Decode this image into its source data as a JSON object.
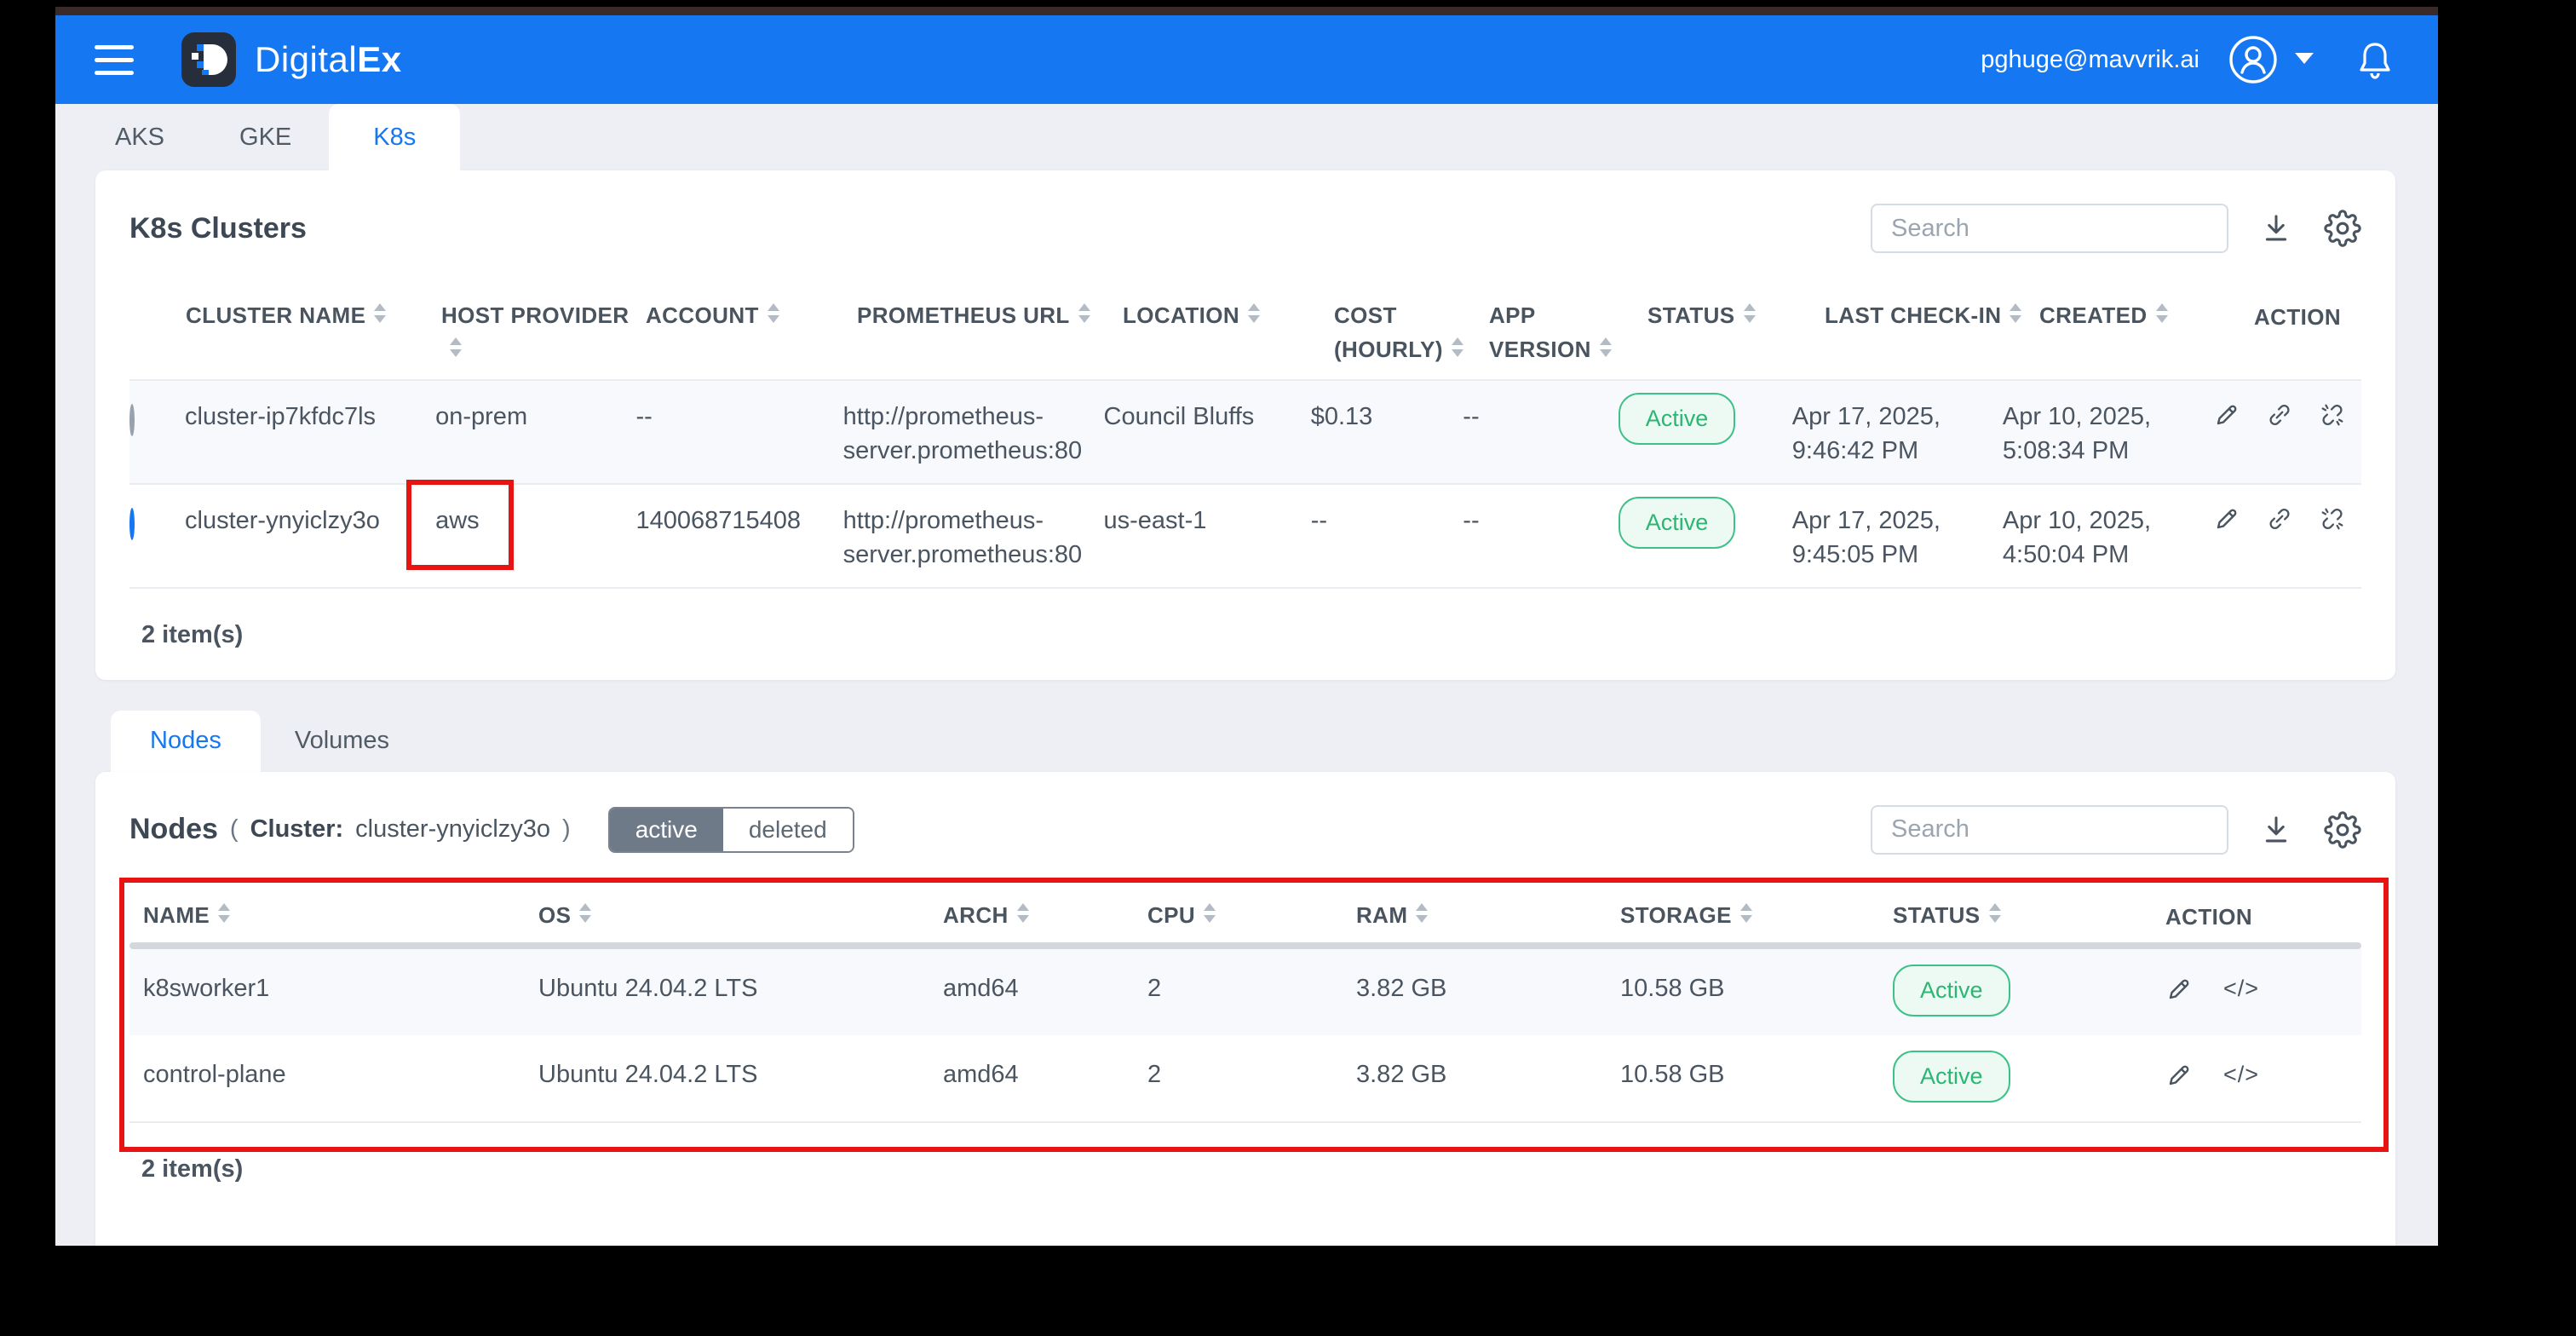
{
  "header": {
    "brand_regular": "Digital",
    "brand_bold": "Ex",
    "user_email": "pghuge@mavvrik.ai"
  },
  "provider_tabs": {
    "aks": "AKS",
    "gke": "GKE",
    "k8s": "K8s"
  },
  "clusters": {
    "title": "K8s Clusters",
    "search_placeholder": "Search",
    "columns": {
      "cluster_name": "CLUSTER NAME",
      "host_provider": "HOST PROVIDER",
      "account": "ACCOUNT",
      "prometheus_url": "PROMETHEUS URL",
      "location": "LOCATION",
      "cost_hourly": "COST (HOURLY)",
      "app_version": "APP VERSION",
      "status": "STATUS",
      "last_check_in": "LAST CHECK-IN",
      "created": "CREATED",
      "action": "ACTION"
    },
    "rows": [
      {
        "selected": false,
        "name": "cluster-ip7kfdc7ls",
        "host_provider": "on-prem",
        "account": "--",
        "prometheus_url": "http://prometheus-server.prometheus:80",
        "location": "Council Bluffs",
        "cost_hourly": "$0.13",
        "app_version": "--",
        "status": "Active",
        "last_check_in": "Apr 17, 2025, 9:46:42 PM",
        "created": "Apr 10, 2025, 5:08:34 PM"
      },
      {
        "selected": true,
        "name": "cluster-ynyiclzy3o",
        "host_provider": "aws",
        "account": "140068715408",
        "prometheus_url": "http://prometheus-server.prometheus:80",
        "location": "us-east-1",
        "cost_hourly": "--",
        "app_version": "--",
        "status": "Active",
        "last_check_in": "Apr 17, 2025, 9:45:05 PM",
        "created": "Apr 10, 2025, 4:50:04 PM"
      }
    ],
    "items_count": "2 item(s)"
  },
  "detail_tabs": {
    "nodes": "Nodes",
    "volumes": "Volumes"
  },
  "nodes": {
    "title": "Nodes",
    "paren_open": "(",
    "cluster_label": "Cluster:",
    "cluster_value": "cluster-ynyiclzy3o",
    "paren_close": ")",
    "toggle_active": "active",
    "toggle_deleted": "deleted",
    "toggle_selected": "active",
    "search_placeholder": "Search",
    "columns": {
      "name": "NAME",
      "os": "OS",
      "arch": "ARCH",
      "cpu": "CPU",
      "ram": "RAM",
      "storage": "STORAGE",
      "status": "STATUS",
      "action": "ACTION"
    },
    "rows": [
      {
        "name": "k8sworker1",
        "os": "Ubuntu 24.04.2 LTS",
        "arch": "amd64",
        "cpu": "2",
        "ram": "3.82 GB",
        "storage": "10.58 GB",
        "status": "Active"
      },
      {
        "name": "control-plane",
        "os": "Ubuntu 24.04.2 LTS",
        "arch": "amd64",
        "cpu": "2",
        "ram": "3.82 GB",
        "storage": "10.58 GB",
        "status": "Active"
      }
    ],
    "items_count": "2 item(s)"
  },
  "icons": {
    "code": "</>"
  },
  "colors": {
    "header_blue": "#1677f2",
    "accent_blue": "#1677f2",
    "active_green": "#2bb673",
    "annotation_red": "#e71414"
  }
}
